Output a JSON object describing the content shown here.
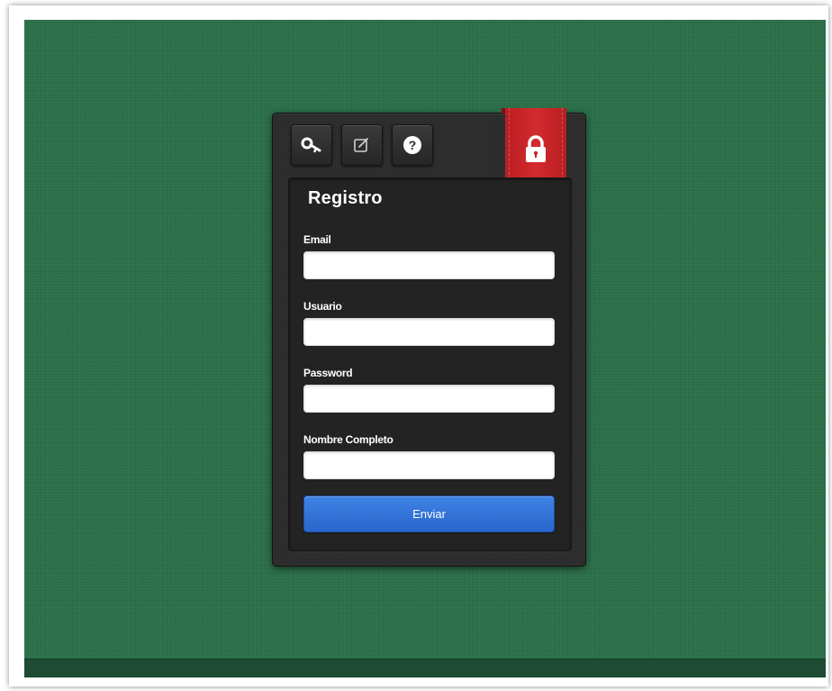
{
  "page": {
    "background_color": "#2a6e48"
  },
  "toolbar": {
    "tabs": [
      {
        "icon": "key-icon",
        "label": "login"
      },
      {
        "icon": "edit-icon",
        "label": "register"
      },
      {
        "icon": "help-icon",
        "label": "help"
      }
    ]
  },
  "ribbon": {
    "icon": "lock-icon",
    "color": "#c9262a"
  },
  "form": {
    "title": "Registro",
    "fields": [
      {
        "label": "Email",
        "value": ""
      },
      {
        "label": "Usuario",
        "value": ""
      },
      {
        "label": "Password",
        "value": ""
      },
      {
        "label": "Nombre Completo",
        "value": ""
      }
    ],
    "submit_label": "Enviar",
    "submit_color": "#2f6fd6"
  }
}
